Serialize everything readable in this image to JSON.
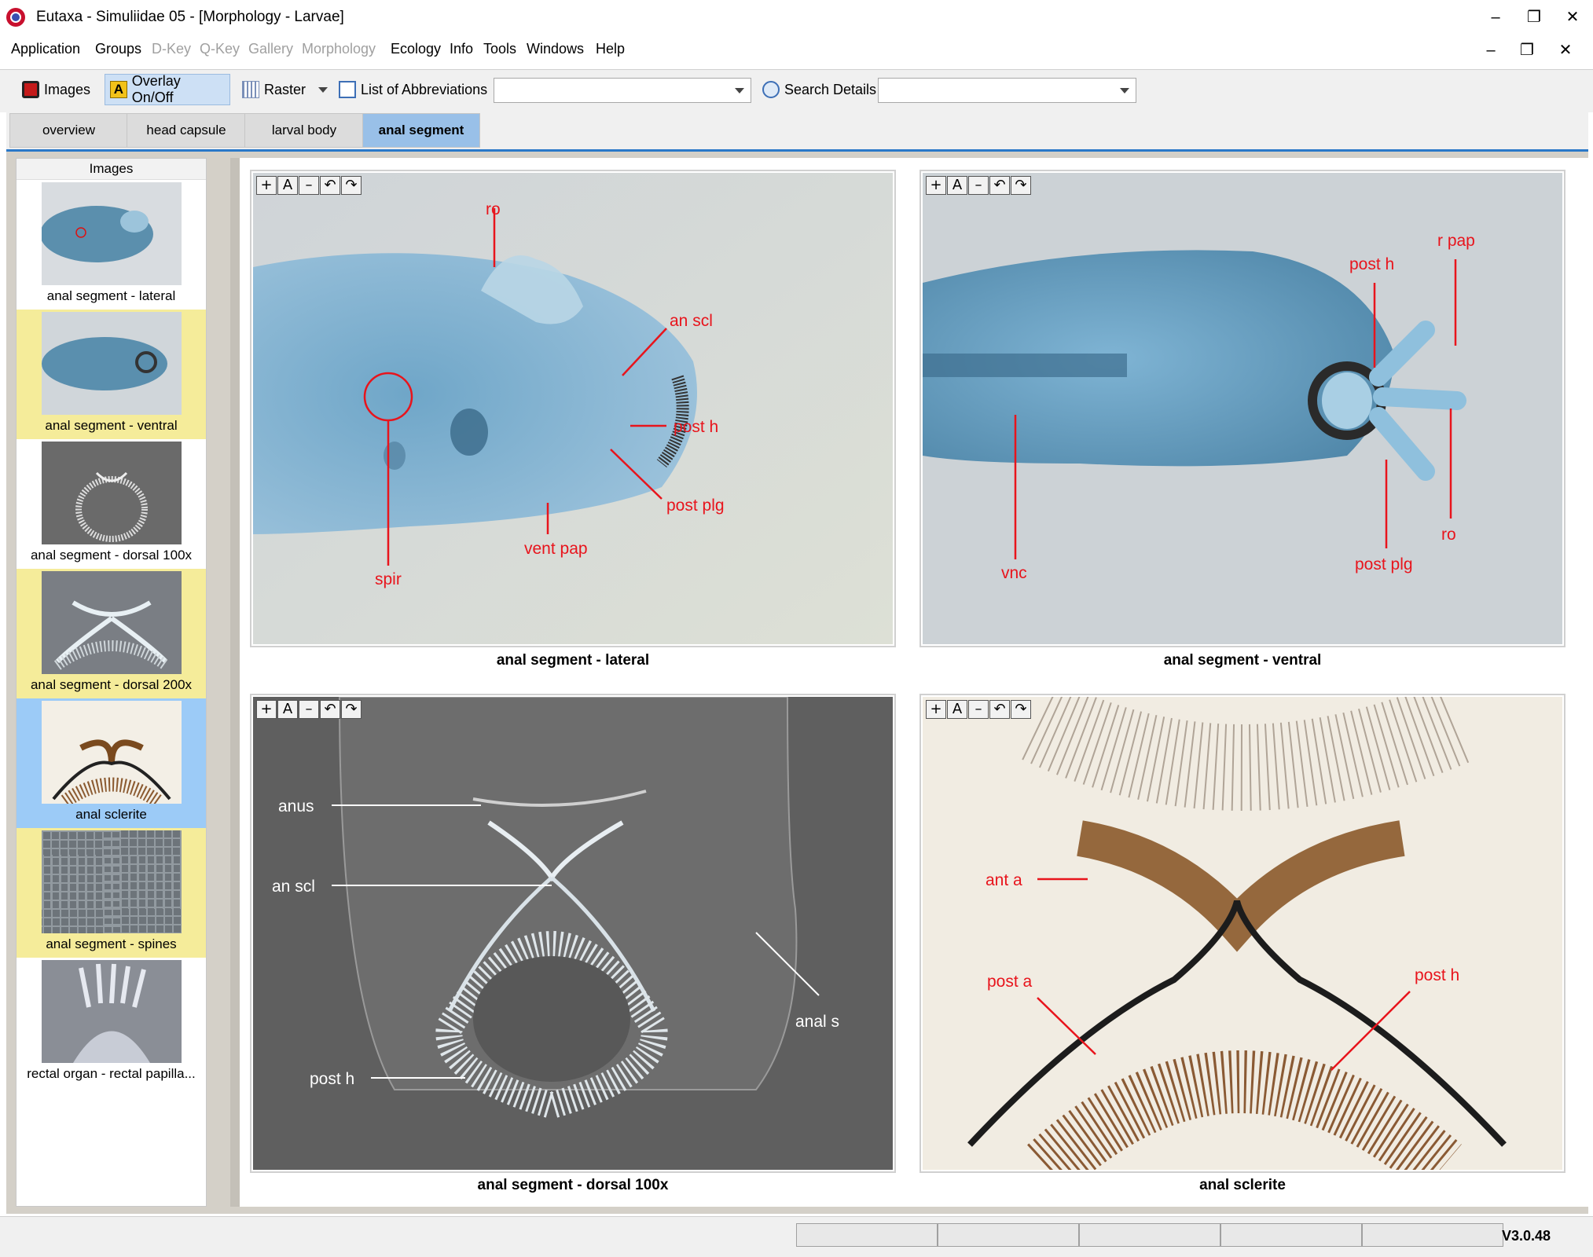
{
  "window": {
    "title": "Eutaxa - Simuliidae 05 - [Morphology - Larvae]",
    "minimize": "–",
    "maximize": "❐",
    "close": "✕"
  },
  "menu": [
    {
      "label": "Application",
      "enabled": true
    },
    {
      "label": "Groups",
      "enabled": true
    },
    {
      "label": "D-Key",
      "enabled": false
    },
    {
      "label": "Q-Key",
      "enabled": false
    },
    {
      "label": "Gallery",
      "enabled": false
    },
    {
      "label": "Morphology",
      "enabled": false
    },
    {
      "label": "Ecology",
      "enabled": true
    },
    {
      "label": "Info",
      "enabled": true
    },
    {
      "label": "Tools",
      "enabled": true
    },
    {
      "label": "Windows",
      "enabled": true
    },
    {
      "label": "Help",
      "enabled": true
    }
  ],
  "toolbar": {
    "images": "Images",
    "overlay": "Overlay On/Off",
    "raster": "Raster",
    "abbreviations": "List of Abbreviations",
    "abbr_value": "",
    "search": "Search Details",
    "search_value": ""
  },
  "tabs": [
    "overview",
    "head capsule",
    "larval body",
    "anal segment"
  ],
  "sidebar": {
    "header": "Images",
    "items": [
      {
        "label": "anal segment - lateral",
        "highlight": "none"
      },
      {
        "label": "anal segment - ventral",
        "highlight": "yellow"
      },
      {
        "label": "anal segment - dorsal 100x",
        "highlight": "none"
      },
      {
        "label": "anal segment - dorsal 200x",
        "highlight": "yellow"
      },
      {
        "label": "anal sclerite",
        "highlight": "blue"
      },
      {
        "label": "anal segment - spines",
        "highlight": "yellow"
      },
      {
        "label": "rectal organ - rectal papilla...",
        "highlight": "none"
      }
    ]
  },
  "image_tools": [
    "+",
    "A",
    "–",
    "↶",
    "↷"
  ],
  "panels": [
    {
      "caption": "anal segment - lateral",
      "labels": [
        "ro",
        "an scl",
        "post h",
        "post plg",
        "vent pap",
        "spir"
      ]
    },
    {
      "caption": "anal segment - ventral",
      "labels": [
        "r pap",
        "post h",
        "vnc",
        "ro",
        "post plg"
      ]
    },
    {
      "caption": "anal segment - dorsal 100x",
      "labels": [
        "anus",
        "an scl",
        "anal s",
        "post h"
      ]
    },
    {
      "caption": "anal sclerite",
      "labels": [
        "ant a",
        "post a",
        "post h"
      ]
    }
  ],
  "status": {
    "version": "V3.0.48"
  },
  "colors": {
    "accent": "#2a78c8",
    "annotation": "#e8141c",
    "highlight_yellow": "#f5ec9a",
    "highlight_blue": "#9ccbf7"
  }
}
